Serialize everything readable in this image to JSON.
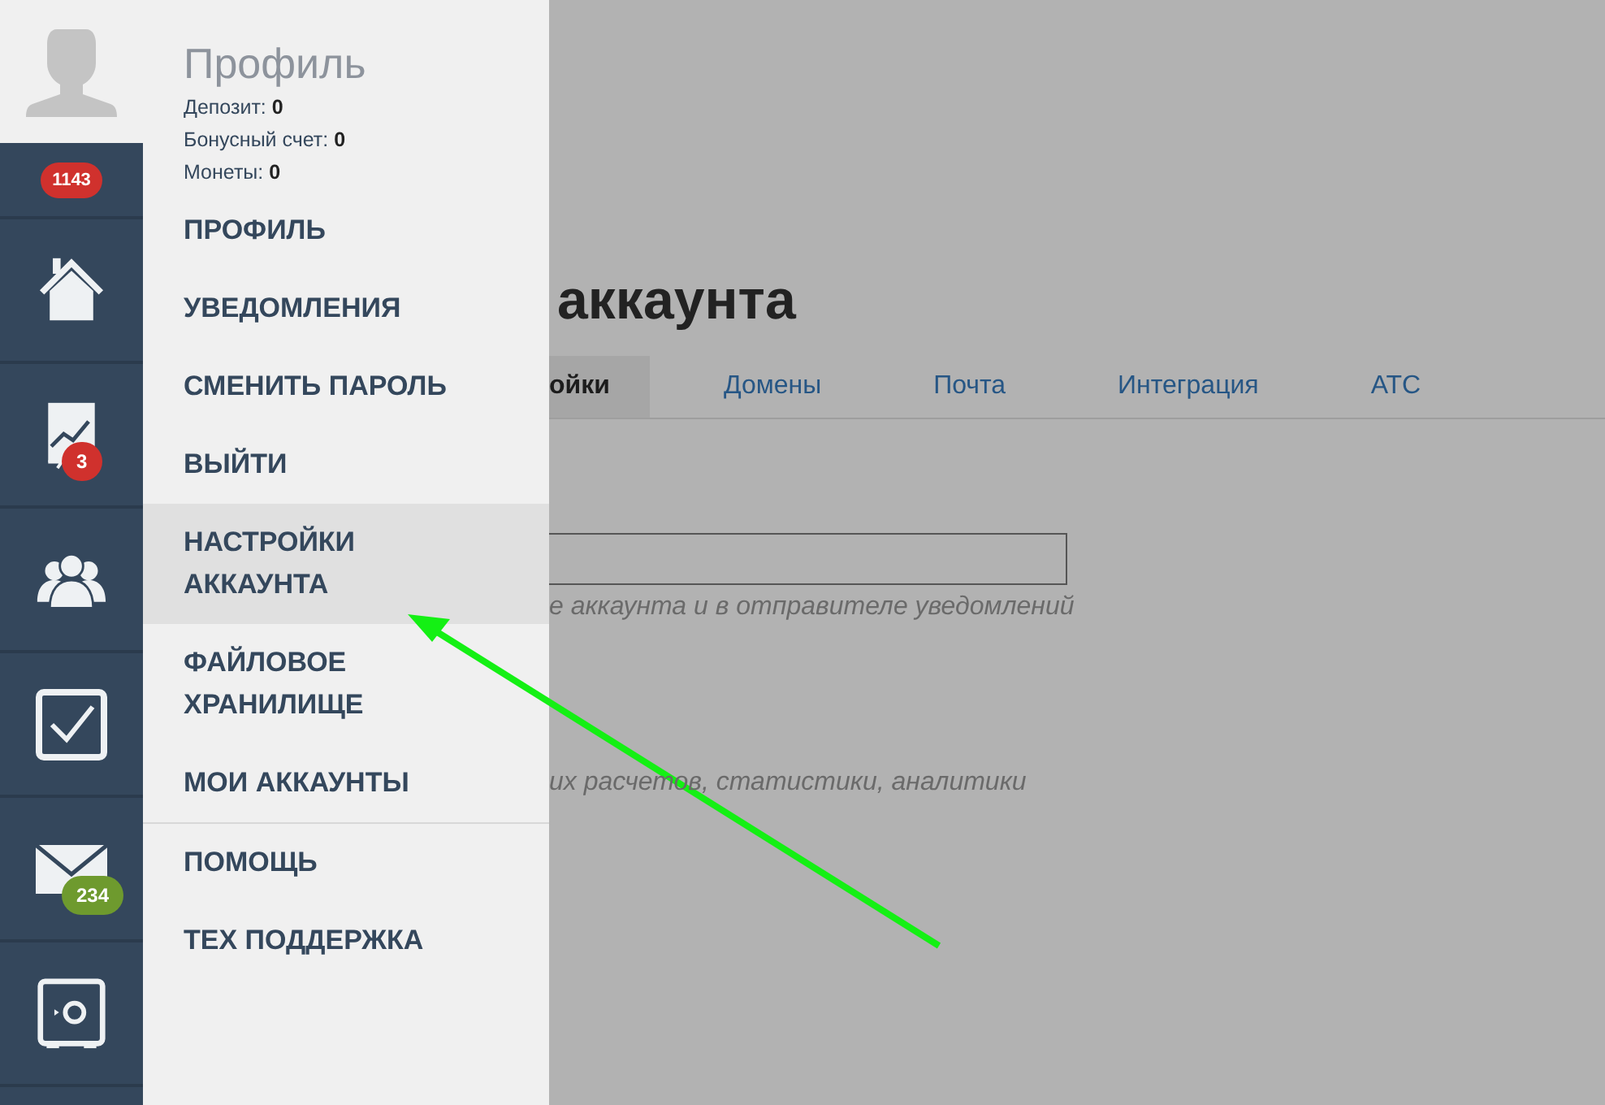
{
  "profile": {
    "title": "Профиль",
    "stats": [
      {
        "label": "Депозит:",
        "value": "0"
      },
      {
        "label": "Бонусный счет:",
        "value": "0"
      },
      {
        "label": "Монеты:",
        "value": "0"
      }
    ]
  },
  "rail": [
    {
      "kind": "counter",
      "badge": "1143",
      "color": "#d0312d"
    },
    {
      "kind": "home"
    },
    {
      "kind": "chart",
      "badge": "3",
      "color": "#d0312d"
    },
    {
      "kind": "people"
    },
    {
      "kind": "tasks"
    },
    {
      "kind": "mail",
      "badge": "234",
      "color": "#6e9a2e"
    },
    {
      "kind": "safe"
    },
    {
      "kind": "blank"
    }
  ],
  "menu": [
    [
      {
        "label": "ПРОФИЛЬ",
        "selected": false
      },
      {
        "label": "УВЕДОМЛЕНИЯ",
        "selected": false
      },
      {
        "label": "СМЕНИТЬ ПАРОЛЬ",
        "selected": false
      },
      {
        "label": "ВЫЙТИ",
        "selected": false
      },
      {
        "label": "НАСТРОЙКИ АККАУНТА",
        "selected": true
      },
      {
        "label": "ФАЙЛОВОЕ ХРАНИЛИЩЕ",
        "selected": false
      },
      {
        "label": "МОИ АККАУНТЫ",
        "selected": false
      }
    ],
    [
      {
        "label": "ПОМОЩЬ",
        "selected": false
      },
      {
        "label": "ТЕХ ПОДДЕРЖКА",
        "selected": false
      }
    ]
  ],
  "page": {
    "heading": "аккаунта",
    "tabs": [
      {
        "label": "ойки",
        "selected": true
      },
      {
        "label": "Домены",
        "selected": false
      },
      {
        "label": "Почта",
        "selected": false
      },
      {
        "label": "Интеграция",
        "selected": false
      },
      {
        "label": "АТС",
        "selected": false
      }
    ],
    "hints": [
      "е аккаунта и в отправителе уведомлений",
      "их расчетов, статистики, аналитики"
    ]
  }
}
